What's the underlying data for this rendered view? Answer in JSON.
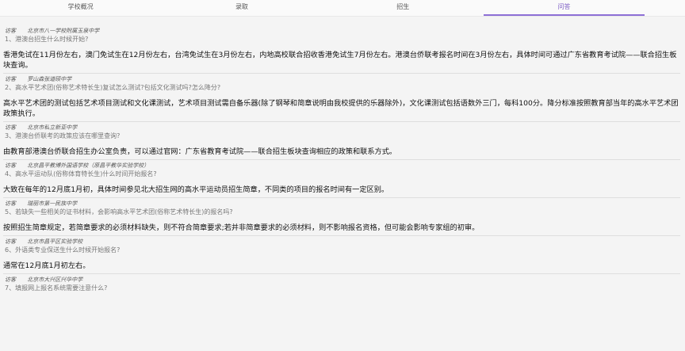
{
  "tabs": [
    {
      "label": "学校概况",
      "active": false
    },
    {
      "label": "录取",
      "active": false
    },
    {
      "label": "招生",
      "active": false
    },
    {
      "label": "问答",
      "active": true
    }
  ],
  "qa": [
    {
      "asker": "访客",
      "school": "北京市八一学校附属玉泉中学",
      "question": "1、港澳台招生什么时候开始?",
      "answer": "香港免试在11月份左右，澳门免试生在12月份左右，台湾免试生在3月份左右，内地高校联合招收香港免试生7月份左右。港澳台侨联考报名时间在3月份左右，具体时间可通过广东省教育考试院——联合招生板块查询。"
    },
    {
      "asker": "访客",
      "school": "罗山森张道硕中学",
      "question": "2、高水平艺术团(俗称艺术特长生)复试怎么测试?包括文化测试吗?怎么降分?",
      "answer": "高水平艺术团的测试包括艺术项目测试和文化课测试，艺术项目测试需自备乐器(除了钢琴和简章说明由我校提供的乐器除外)，文化课测试包括语数外三门，每科100分。降分标准按照教育部当年的高水平艺术团政策执行。"
    },
    {
      "asker": "访客",
      "school": "北京市私立新亚中学",
      "question": "3、港澳台侨联考的政策应该在哪里查询?",
      "answer": "由教育部港澳台侨联合招生办公室负责，可以通过官网：广东省教育考试院——联合招生板块查询相应的政策和联系方式。"
    },
    {
      "asker": "访客",
      "school": "北京昌平教博外国语学校（原昌平教华实验学校）",
      "question": "4、高水平运动队(俗称体育特长生)什么时间开始报名?",
      "answer": "大致在每年的12月底1月初，具体时间参见北大招生网的高水平运动员招生简章，不同类的项目的报名时间有一定区别。"
    },
    {
      "asker": "访客",
      "school": "瑞丽市第一民族中学",
      "question": "5、若缺失一些相关的证书材料，会影响高水平艺术团(俗称艺术特长生)的报名吗?",
      "answer": "按照招生简章规定，若简章要求的必须材料缺失，则不符合简章要求;若并非简章要求的必须材料，则不影响报名资格，但可能会影响专家组的初审。"
    },
    {
      "asker": "访客",
      "school": "北京市昌平区实验学校",
      "question": "6、外语类专业保送生什么时候开始报名?",
      "answer": "通常在12月底1月初左右。"
    },
    {
      "asker": "访客",
      "school": "北京市大兴区兴华中学",
      "question": "7、填报网上报名系统需要注意什么?",
      "answer": ""
    }
  ]
}
